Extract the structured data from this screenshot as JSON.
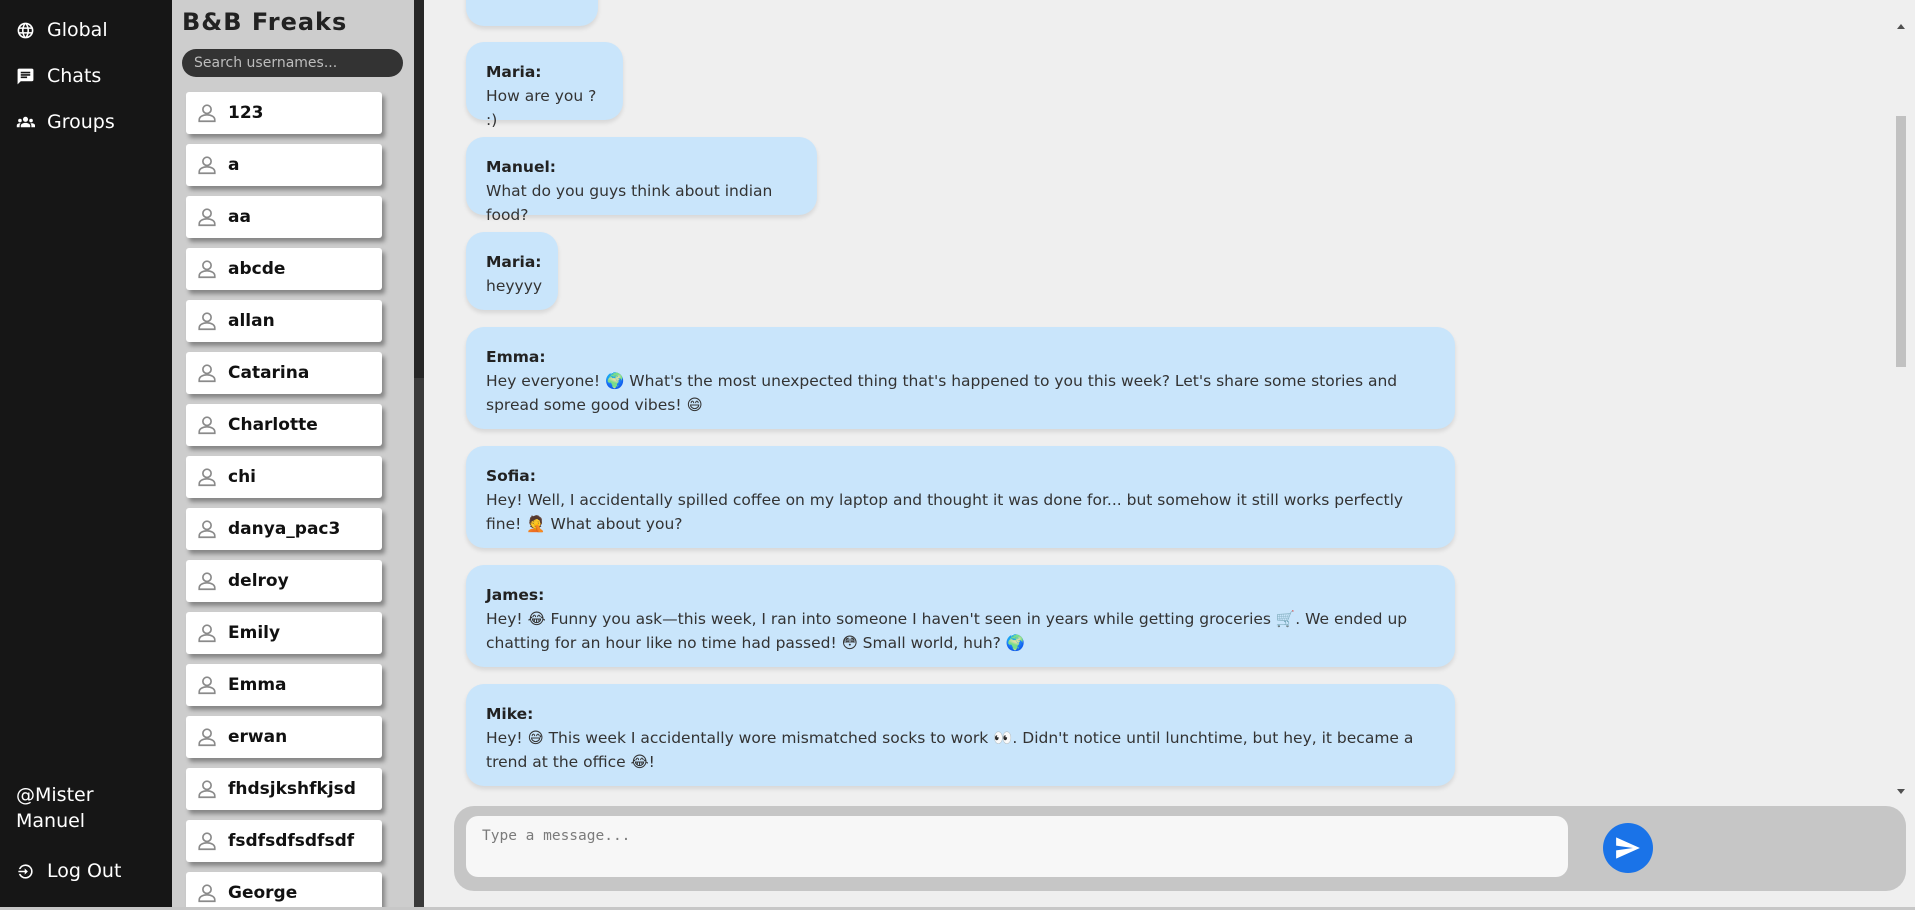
{
  "nav": {
    "items": [
      {
        "label": "Global",
        "icon": "globe-icon"
      },
      {
        "label": "Chats",
        "icon": "chat-icon"
      },
      {
        "label": "Groups",
        "icon": "groups-icon"
      }
    ],
    "user_handle": "@Mister Manuel",
    "logout_label": "Log Out"
  },
  "userpanel": {
    "title": "B&B Freaks",
    "search_placeholder": "Search usernames...",
    "users": [
      "123",
      "a",
      "aa",
      "abcde",
      "allan",
      "Catarina",
      "Charlotte",
      "chi",
      "danya_pac3",
      "delroy",
      "Emily",
      "Emma",
      "erwan",
      "fhdsjkshfkjsd",
      "fsdfsdfsdfsdf",
      "George"
    ]
  },
  "messages": [
    {
      "author": "Maria:",
      "text": "How are you ? :)"
    },
    {
      "author": "Manuel:",
      "text": "What do you guys think about indian food?"
    },
    {
      "author": "Maria:",
      "text": "heyyyy"
    },
    {
      "author": "Emma:",
      "text": "Hey everyone! 🌍 What's the most unexpected thing that's happened to you this week? Let's share some stories and spread some good vibes! 😄"
    },
    {
      "author": "Sofia:",
      "text": "Hey! Well, I accidentally spilled coffee on my laptop and thought it was done for... but somehow it still works perfectly fine! 🤦 What about you?"
    },
    {
      "author": "James:",
      "text": "Hey! 😂 Funny you ask—this week, I ran into someone I haven't seen in years while getting groceries 🛒. We ended up chatting for an hour like no time had passed! 😳 Small world, huh? 🌍"
    },
    {
      "author": "Mike:",
      "text": "Hey! 😅 This week I accidentally wore mismatched socks to work 👀. Didn't notice until lunchtime, but hey, it became a trend at the office 😂!"
    }
  ],
  "composer": {
    "placeholder": "Type a message...",
    "send_icon": "send-icon"
  },
  "colors": {
    "nav_bg": "#161616",
    "panel_bg": "#cdcdcd",
    "bubble": "#c9e5fb",
    "send": "#1a73e8"
  }
}
